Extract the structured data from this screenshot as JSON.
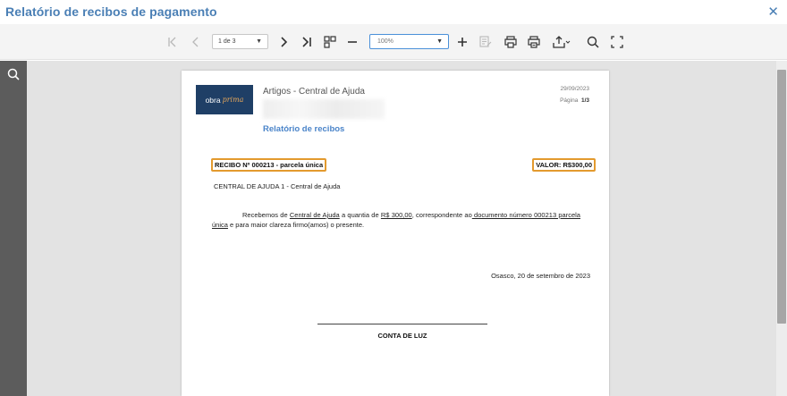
{
  "window": {
    "title": "Relatório de recibos de pagamento",
    "close_icon": "close-icon"
  },
  "toolbar": {
    "first_icon": "first-page-icon",
    "prev_icon": "previous-page-icon",
    "page_select": "1 de 3",
    "next_icon": "next-page-icon",
    "last_icon": "last-page-icon",
    "zoom_value": "100%",
    "icons": [
      "multipage-view-icon",
      "zoom-out-icon",
      "zoom-in-icon",
      "edit-document-icon",
      "print-icon",
      "print-preview-icon",
      "export-icon",
      "search-icon",
      "fullscreen-icon"
    ],
    "accent": "#4a90d9"
  },
  "sidebar": {
    "search_icon": "search-icon"
  },
  "document": {
    "logo_text": "obra",
    "logo_script": "prima",
    "title": "Artigos - Central de Ajuda",
    "date": "29/09/2023",
    "page_label": "Página",
    "page_value": "1/3",
    "report_title": "Relatório de recibos",
    "receipt_label": "RECIBO Nº 000213 - parcela única",
    "value_label": "VALOR: R$300,00",
    "payer_line": "CENTRAL DE AJUDA 1 - Central de Ajuda",
    "paragraph": {
      "p1": "Recebemos de ",
      "payer": "Central de Ajuda",
      "p2": " a quantia de ",
      "amount": "R$ 300,00",
      "p3": ", correspondente ao",
      "doc": " documento número 000213 parcela única",
      "p4": " e para maior clareza firmo(amos) o presente."
    },
    "place_date": "Osasco, 20 de setembro de 2023",
    "signature_name": "CONTA DE LUZ",
    "highlight_color": "#e39a2e"
  }
}
